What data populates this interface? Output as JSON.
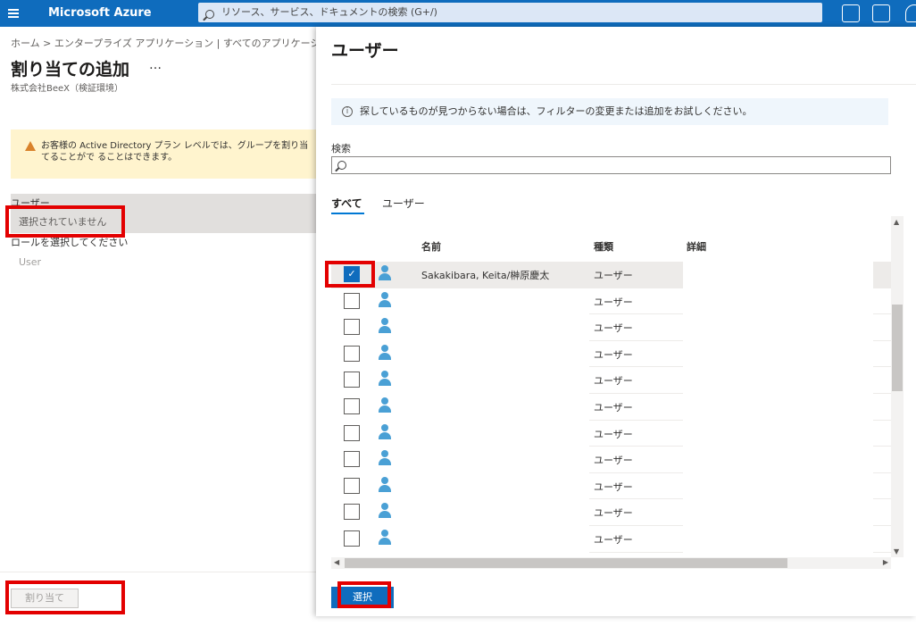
{
  "topbar": {
    "brand": "Microsoft Azure",
    "search_placeholder": "リソース、サービス、ドキュメントの検索 (G+/)"
  },
  "left": {
    "breadcrumb": "ホーム  >  エンタープライズ アプリケーション | すべてのアプリケーション  >  Az",
    "title": "割り当ての追加",
    "more": "…",
    "subtitle": "株式会社BeeX（検証環境）",
    "warning": "お客様の Active Directory プラン レベルでは、グループを割り当てることがで ることはできます。",
    "user_label": "ユーザー",
    "user_value": "選択されていません",
    "role_label": "ロールを選択してください",
    "role_value": "User",
    "assign_button": "割り当て"
  },
  "panel": {
    "title": "ユーザー",
    "info": "探しているものが見つからない場合は、フィルターの変更または追加をお試しください。",
    "search_label": "検索",
    "tabs": [
      "すべて",
      "ユーザー"
    ],
    "columns": [
      "名前",
      "種類",
      "詳細"
    ],
    "rows": [
      {
        "name": "Sakakibara, Keita/榊原慶太",
        "type": "ユーザー",
        "selected": true
      },
      {
        "name": "",
        "type": "ユーザー",
        "selected": false
      },
      {
        "name": "",
        "type": "ユーザー",
        "selected": false
      },
      {
        "name": "",
        "type": "ユーザー",
        "selected": false
      },
      {
        "name": "",
        "type": "ユーザー",
        "selected": false
      },
      {
        "name": "",
        "type": "ユーザー",
        "selected": false
      },
      {
        "name": "",
        "type": "ユーザー",
        "selected": false
      },
      {
        "name": "",
        "type": "ユーザー",
        "selected": false
      },
      {
        "name": "",
        "type": "ユーザー",
        "selected": false
      },
      {
        "name": "",
        "type": "ユーザー",
        "selected": false
      },
      {
        "name": "",
        "type": "ユーザー",
        "selected": false
      }
    ],
    "select_button": "選択",
    "checkmark": "✓"
  }
}
